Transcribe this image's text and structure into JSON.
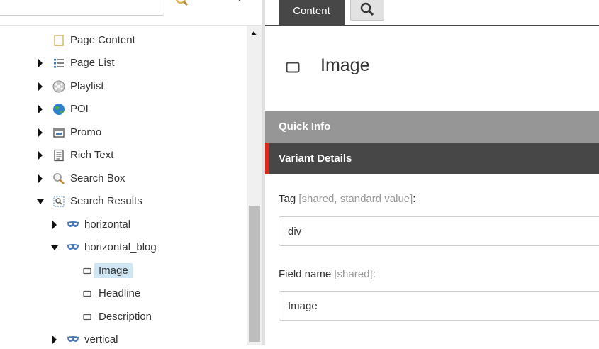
{
  "tree": {
    "items": [
      {
        "label": "Page Content",
        "icon": "page-content-icon",
        "arrow": "none"
      },
      {
        "label": "Page List",
        "icon": "page-list-icon",
        "arrow": "right"
      },
      {
        "label": "Playlist",
        "icon": "playlist-icon",
        "arrow": "right"
      },
      {
        "label": "POI",
        "icon": "globe-icon",
        "arrow": "right"
      },
      {
        "label": "Promo",
        "icon": "promo-icon",
        "arrow": "right"
      },
      {
        "label": "Rich Text",
        "icon": "rich-text-icon",
        "arrow": "right"
      },
      {
        "label": "Search Box",
        "icon": "magnifier-icon",
        "arrow": "right"
      },
      {
        "label": "Search Results",
        "icon": "search-results-icon",
        "arrow": "down"
      },
      {
        "label": "horizontal",
        "icon": "mask-icon",
        "arrow": "right"
      },
      {
        "label": "horizontal_blog",
        "icon": "mask-icon",
        "arrow": "down"
      },
      {
        "label": "Image",
        "icon": "field-icon",
        "arrow": "none",
        "selected": true
      },
      {
        "label": "Headline",
        "icon": "field-icon",
        "arrow": "none"
      },
      {
        "label": "Description",
        "icon": "field-icon",
        "arrow": "none"
      },
      {
        "label": "vertical",
        "icon": "mask-icon",
        "arrow": "right"
      }
    ]
  },
  "tabs": {
    "content_label": "Content",
    "search_icon": "search-icon"
  },
  "item": {
    "title": "Image",
    "icon": "field-icon"
  },
  "sections": {
    "quick_info": "Quick Info",
    "variant_details": "Variant Details"
  },
  "fields": {
    "tag": {
      "label": "Tag",
      "hint": "[shared, standard value]",
      "suffix": ":",
      "value": "div"
    },
    "field_name": {
      "label": "Field name",
      "hint": "[shared]",
      "suffix": ":",
      "value": "Image"
    }
  },
  "colors": {
    "tab_active": "#474747",
    "section_collapsed": "#969696",
    "section_expanded": "#474747",
    "section_accent": "#dc291e",
    "selection": "#cfe6f5"
  }
}
